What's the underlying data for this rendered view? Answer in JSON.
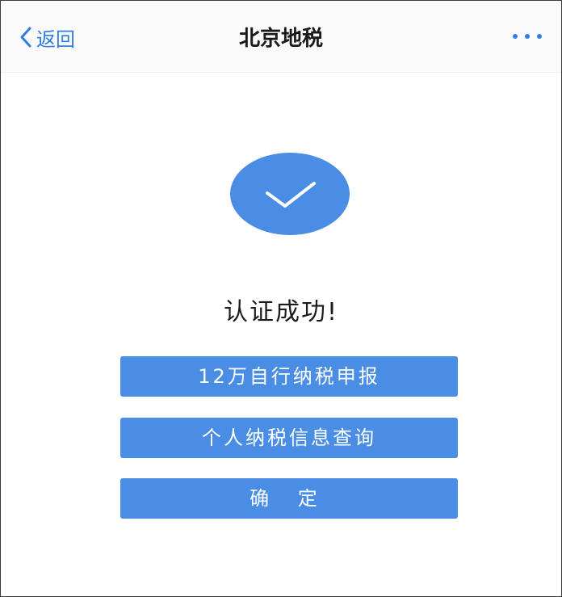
{
  "nav": {
    "back_label": "返回",
    "title": "北京地税",
    "more_icon": "more-dots-icon",
    "accent_color": "#2f7de1"
  },
  "result": {
    "icon": "checkmark-icon",
    "icon_color": "#4a8de4",
    "message": "认证成功!"
  },
  "actions": {
    "declare_label": "12万自行纳税申报",
    "query_label": "个人纳税信息查询",
    "confirm_label": "确 定",
    "button_color": "#4a8de4"
  }
}
